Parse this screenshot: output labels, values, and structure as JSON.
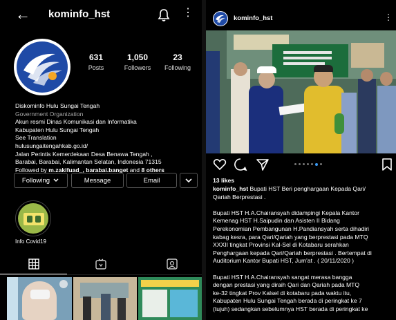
{
  "profile": {
    "username": "kominfo_hst",
    "stats": [
      {
        "value": "631",
        "label": "Posts"
      },
      {
        "value": "1,050",
        "label": "Followers"
      },
      {
        "value": "23",
        "label": "Following"
      }
    ],
    "bio": {
      "name": "Diskominfo Hulu Sungai Tengah",
      "category": "Government Organization",
      "line1": "Akun resmi Dinas Komunikasi dan Informatika",
      "line2": "Kabupaten Hulu Sungai Tengah",
      "see_translation": "See Translation",
      "website": "hulusungaitengahkab.go.id/",
      "address1": "Jalan Perintis Kemerdekaan Desa Benawa Tengah ,",
      "address2": "Barabai, Barabai, Kalimantan Selatan, Indonesia 71315",
      "followed_prefix": "Followed by",
      "followed_users": "m.zakifuad_, barabai.banget",
      "followed_and": "and",
      "followed_others": "8 others"
    },
    "buttons": {
      "following": "Following",
      "message": "Message",
      "email": "Email"
    },
    "highlight": {
      "label": "Info Covid19"
    }
  },
  "post": {
    "username": "kominfo_hst",
    "likes": "13 likes",
    "caption_user": "kominfo_hst",
    "caption_lines": [
      "Bupati HST Beri penghargaan Kepada Qari/",
      "Qariah Berprestasi .",
      "",
      "Bupati HST H.A.Chairansyah didampingi  Kepala Kantor",
      "Kemenag  HST  H.Saipudin  dan Asisten II Bidang",
      "Perekonomian Pembangunan H.Pandiansyah serta dihadiri",
      "kabag kesra, para Qari/Qariah yang berprestasi pada MTQ",
      "XXXII tingkat Provinsi Kal-Sel di Kotabaru serahkan",
      "Penghargaan kepada Qari/Qariah berprestasi . Bertempat di",
      "Auditorium Kantor Bupati  HST, Jum'at . ( 20/11/2020 )",
      "",
      "Bupati HST H.A.Chairansyah sangat merasa bangga",
      "dengan prestasi yang diraih Qari dan Qariah pada MTQ",
      "ke-32 tingkat Prov Kalsel  di kotabaru pada waktu itu,",
      "Kabupaten Hulu Sungai Tengah berada di peringkat ke 7",
      "(tujuh) sedangkan sebelumnya HST berada di peringkat ke"
    ]
  },
  "colors": {
    "background": "#000000",
    "accent": "#3897f0",
    "muted": "#a8a8a8"
  }
}
